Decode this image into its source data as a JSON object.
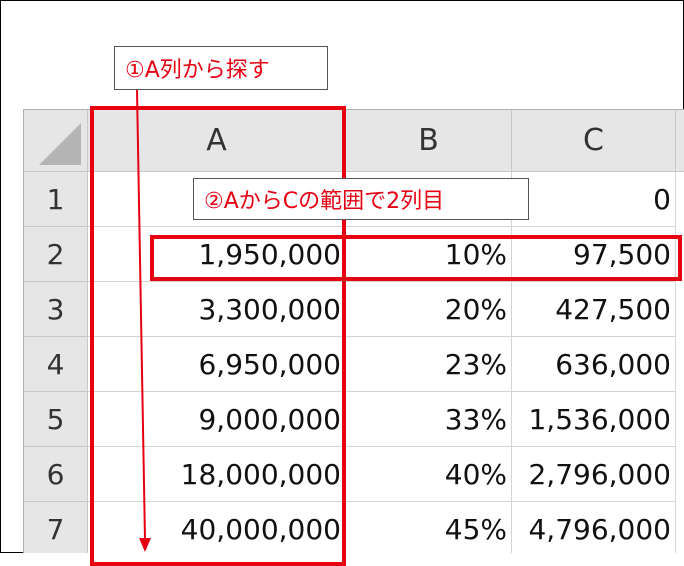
{
  "callouts": {
    "search_col": "①A列から探す",
    "range_col": "②AからCの範囲で2列目"
  },
  "columns": [
    "A",
    "B",
    "C"
  ],
  "rows": [
    {
      "num": "1",
      "a": "",
      "b": "",
      "c": "0"
    },
    {
      "num": "2",
      "a": "1,950,000",
      "b": "10%",
      "c": "97,500"
    },
    {
      "num": "3",
      "a": "3,300,000",
      "b": "20%",
      "c": "427,500"
    },
    {
      "num": "4",
      "a": "6,950,000",
      "b": "23%",
      "c": "636,000"
    },
    {
      "num": "5",
      "a": "9,000,000",
      "b": "33%",
      "c": "1,536,000"
    },
    {
      "num": "6",
      "a": "18,000,000",
      "b": "40%",
      "c": "2,796,000"
    },
    {
      "num": "7",
      "a": "40,000,000",
      "b": "45%",
      "c": "4,796,000"
    }
  ],
  "colors": {
    "highlight": "#e60012",
    "header_bg": "#e6e6e6"
  }
}
